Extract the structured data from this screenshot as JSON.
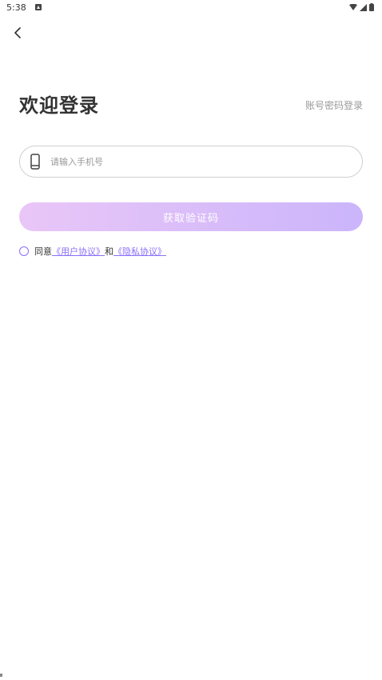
{
  "status_bar": {
    "time": "5:38"
  },
  "header": {
    "back_icon": "chevron-left-icon"
  },
  "title": "欢迎登录",
  "password_login_label": "账号密码登录",
  "phone_input": {
    "value": "",
    "placeholder": "请输入手机号",
    "icon": "phone-icon"
  },
  "get_code_label": "获取验证码",
  "agreement": {
    "prefix": "同意",
    "user_agreement": "《用户协议》",
    "and": "和",
    "privacy_policy": "《隐私协议》"
  },
  "colors": {
    "accent": "#8c6ff7",
    "button_gradient_start": "#e9c6f7",
    "button_gradient_end": "#cbb5fb",
    "text_primary": "#333333",
    "text_secondary": "#999999"
  }
}
